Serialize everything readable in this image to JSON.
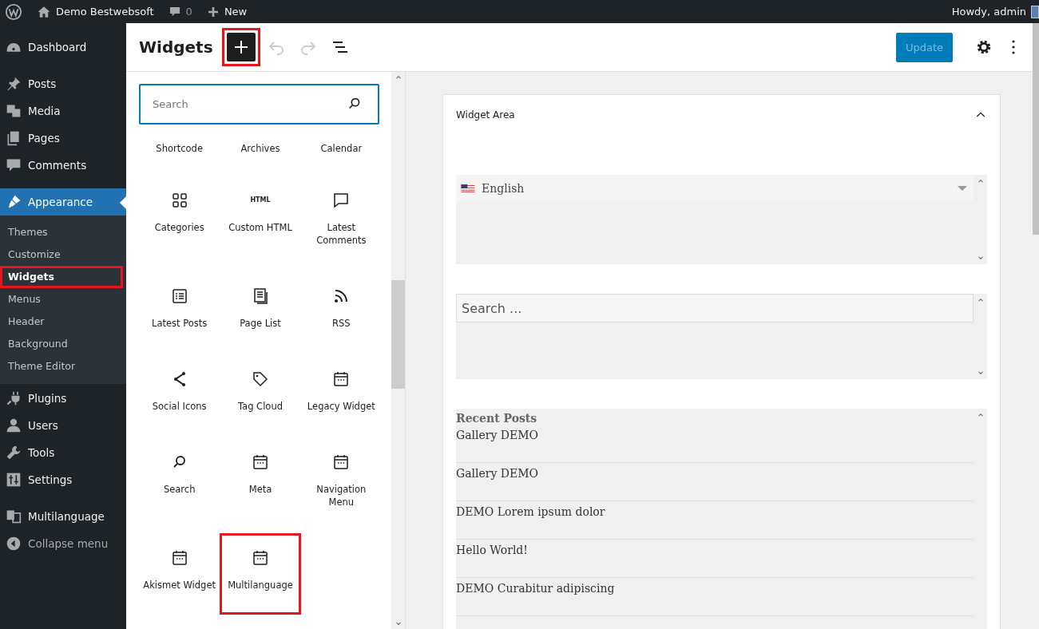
{
  "admin_bar": {
    "site_name": "Demo Bestwebsoft",
    "comments_count": "0",
    "new_label": "New",
    "greeting": "Howdy, admin"
  },
  "sidebar": {
    "items": [
      {
        "label": "Dashboard",
        "current": false
      },
      {
        "label": "Posts",
        "current": false
      },
      {
        "label": "Media",
        "current": false
      },
      {
        "label": "Pages",
        "current": false
      },
      {
        "label": "Comments",
        "current": false
      },
      {
        "label": "Appearance",
        "current": true,
        "children": [
          {
            "label": "Themes",
            "selected": false,
            "highlighted": false
          },
          {
            "label": "Customize",
            "selected": false,
            "highlighted": false
          },
          {
            "label": "Widgets",
            "selected": true,
            "highlighted": true
          },
          {
            "label": "Menus",
            "selected": false,
            "highlighted": false
          },
          {
            "label": "Header",
            "selected": false,
            "highlighted": false
          },
          {
            "label": "Background",
            "selected": false,
            "highlighted": false
          },
          {
            "label": "Theme Editor",
            "selected": false,
            "highlighted": false
          }
        ]
      },
      {
        "label": "Plugins",
        "current": false
      },
      {
        "label": "Users",
        "current": false
      },
      {
        "label": "Tools",
        "current": false
      },
      {
        "label": "Settings",
        "current": false
      },
      {
        "label": "Multilanguage",
        "current": false
      },
      {
        "label": "Collapse menu",
        "current": false
      }
    ]
  },
  "editor_header": {
    "title": "Widgets",
    "add_button": {
      "on": true,
      "highlighted": true
    },
    "update_label": "Update"
  },
  "inserter": {
    "search": {
      "placeholder": "Search"
    },
    "blocks": [
      {
        "label": "Shortcode",
        "highlighted": false
      },
      {
        "label": "Archives",
        "highlighted": false
      },
      {
        "label": "Calendar",
        "highlighted": false
      },
      {
        "label": "Categories",
        "highlighted": false
      },
      {
        "label": "Custom HTML",
        "icon_text": "HTML",
        "highlighted": false
      },
      {
        "label": "Latest Comments",
        "highlighted": false
      },
      {
        "label": "Latest Posts",
        "highlighted": false
      },
      {
        "label": "Page List",
        "highlighted": false
      },
      {
        "label": "RSS",
        "highlighted": false
      },
      {
        "label": "Social Icons",
        "highlighted": false
      },
      {
        "label": "Tag Cloud",
        "highlighted": false
      },
      {
        "label": "Legacy Widget",
        "highlighted": false
      },
      {
        "label": "Search",
        "highlighted": false
      },
      {
        "label": "Meta",
        "highlighted": false
      },
      {
        "label": "Navigation Menu",
        "highlighted": false
      },
      {
        "label": "Akismet Widget",
        "highlighted": false
      },
      {
        "label": "Multilanguage",
        "highlighted": true
      }
    ]
  },
  "widget_area": {
    "title": "Widget Area",
    "expanded": true,
    "widgets": [
      {
        "kind": "language",
        "value": "English"
      },
      {
        "kind": "search",
        "placeholder": "Search ..."
      },
      {
        "kind": "posts",
        "title": "Recent Posts",
        "items": [
          "Gallery DEMO",
          "Gallery DEMO",
          "DEMO Lorem ipsum dolor",
          "Hello World!",
          "DEMO Curabitur adipiscing"
        ]
      }
    ]
  }
}
